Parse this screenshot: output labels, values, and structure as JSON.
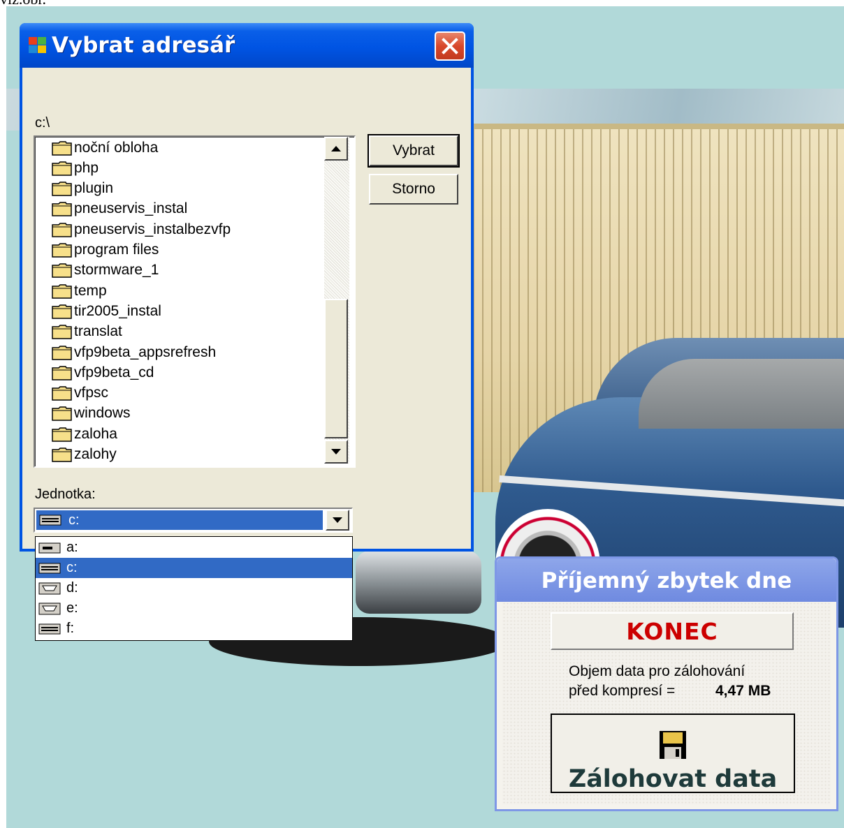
{
  "page_caption": "viz.obr.",
  "dialog": {
    "title": "Vybrat adresář",
    "path": "c:\\",
    "folders": [
      "noční obloha",
      "php",
      "plugin",
      "pneuservis_instal",
      "pneuservis_instalbezvfp",
      "program files",
      "stormware_1",
      "temp",
      "tir2005_instal",
      "translat",
      "vfp9beta_appsrefresh",
      "vfp9beta_cd",
      "vfpsc",
      "windows",
      "zaloha",
      "zalohy"
    ],
    "select_button": "Vybrat",
    "cancel_button": "Storno",
    "drive_label": "Jednotka:",
    "drive_selected": "c:",
    "drives": [
      "a:",
      "c:",
      "d:",
      "e:",
      "f:"
    ],
    "drive_icons": [
      "floppy-drive-icon",
      "hard-drive-icon",
      "cd-drive-icon",
      "cd-drive-icon",
      "hard-drive-icon"
    ]
  },
  "panel": {
    "title": "Příjemný zbytek dne",
    "exit_button": "KONEC",
    "info_line1": "Objem data pro zálohování",
    "info_line2": "před kompresí =",
    "info_value": "4,47 MB",
    "backup_button": "Zálohovat data"
  },
  "colors": {
    "titlebar": "#0054e3",
    "selection": "#316ac5",
    "exit_text": "#cc0000",
    "background": "#b1d9d9"
  }
}
